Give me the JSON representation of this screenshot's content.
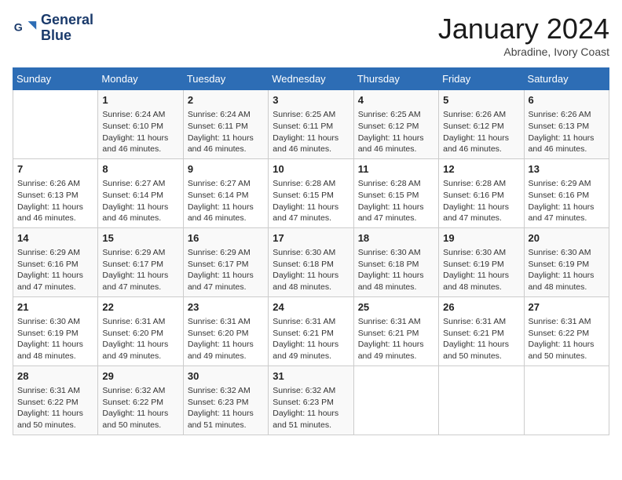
{
  "header": {
    "logo": {
      "line1": "General",
      "line2": "Blue"
    },
    "month": "January 2024",
    "location": "Abradine, Ivory Coast"
  },
  "weekdays": [
    "Sunday",
    "Monday",
    "Tuesday",
    "Wednesday",
    "Thursday",
    "Friday",
    "Saturday"
  ],
  "weeks": [
    [
      {
        "day": "",
        "info": ""
      },
      {
        "day": "1",
        "info": "Sunrise: 6:24 AM\nSunset: 6:10 PM\nDaylight: 11 hours\nand 46 minutes."
      },
      {
        "day": "2",
        "info": "Sunrise: 6:24 AM\nSunset: 6:11 PM\nDaylight: 11 hours\nand 46 minutes."
      },
      {
        "day": "3",
        "info": "Sunrise: 6:25 AM\nSunset: 6:11 PM\nDaylight: 11 hours\nand 46 minutes."
      },
      {
        "day": "4",
        "info": "Sunrise: 6:25 AM\nSunset: 6:12 PM\nDaylight: 11 hours\nand 46 minutes."
      },
      {
        "day": "5",
        "info": "Sunrise: 6:26 AM\nSunset: 6:12 PM\nDaylight: 11 hours\nand 46 minutes."
      },
      {
        "day": "6",
        "info": "Sunrise: 6:26 AM\nSunset: 6:13 PM\nDaylight: 11 hours\nand 46 minutes."
      }
    ],
    [
      {
        "day": "7",
        "info": "Sunrise: 6:26 AM\nSunset: 6:13 PM\nDaylight: 11 hours\nand 46 minutes."
      },
      {
        "day": "8",
        "info": "Sunrise: 6:27 AM\nSunset: 6:14 PM\nDaylight: 11 hours\nand 46 minutes."
      },
      {
        "day": "9",
        "info": "Sunrise: 6:27 AM\nSunset: 6:14 PM\nDaylight: 11 hours\nand 46 minutes."
      },
      {
        "day": "10",
        "info": "Sunrise: 6:28 AM\nSunset: 6:15 PM\nDaylight: 11 hours\nand 47 minutes."
      },
      {
        "day": "11",
        "info": "Sunrise: 6:28 AM\nSunset: 6:15 PM\nDaylight: 11 hours\nand 47 minutes."
      },
      {
        "day": "12",
        "info": "Sunrise: 6:28 AM\nSunset: 6:16 PM\nDaylight: 11 hours\nand 47 minutes."
      },
      {
        "day": "13",
        "info": "Sunrise: 6:29 AM\nSunset: 6:16 PM\nDaylight: 11 hours\nand 47 minutes."
      }
    ],
    [
      {
        "day": "14",
        "info": "Sunrise: 6:29 AM\nSunset: 6:16 PM\nDaylight: 11 hours\nand 47 minutes."
      },
      {
        "day": "15",
        "info": "Sunrise: 6:29 AM\nSunset: 6:17 PM\nDaylight: 11 hours\nand 47 minutes."
      },
      {
        "day": "16",
        "info": "Sunrise: 6:29 AM\nSunset: 6:17 PM\nDaylight: 11 hours\nand 47 minutes."
      },
      {
        "day": "17",
        "info": "Sunrise: 6:30 AM\nSunset: 6:18 PM\nDaylight: 11 hours\nand 48 minutes."
      },
      {
        "day": "18",
        "info": "Sunrise: 6:30 AM\nSunset: 6:18 PM\nDaylight: 11 hours\nand 48 minutes."
      },
      {
        "day": "19",
        "info": "Sunrise: 6:30 AM\nSunset: 6:19 PM\nDaylight: 11 hours\nand 48 minutes."
      },
      {
        "day": "20",
        "info": "Sunrise: 6:30 AM\nSunset: 6:19 PM\nDaylight: 11 hours\nand 48 minutes."
      }
    ],
    [
      {
        "day": "21",
        "info": "Sunrise: 6:30 AM\nSunset: 6:19 PM\nDaylight: 11 hours\nand 48 minutes."
      },
      {
        "day": "22",
        "info": "Sunrise: 6:31 AM\nSunset: 6:20 PM\nDaylight: 11 hours\nand 49 minutes."
      },
      {
        "day": "23",
        "info": "Sunrise: 6:31 AM\nSunset: 6:20 PM\nDaylight: 11 hours\nand 49 minutes."
      },
      {
        "day": "24",
        "info": "Sunrise: 6:31 AM\nSunset: 6:21 PM\nDaylight: 11 hours\nand 49 minutes."
      },
      {
        "day": "25",
        "info": "Sunrise: 6:31 AM\nSunset: 6:21 PM\nDaylight: 11 hours\nand 49 minutes."
      },
      {
        "day": "26",
        "info": "Sunrise: 6:31 AM\nSunset: 6:21 PM\nDaylight: 11 hours\nand 50 minutes."
      },
      {
        "day": "27",
        "info": "Sunrise: 6:31 AM\nSunset: 6:22 PM\nDaylight: 11 hours\nand 50 minutes."
      }
    ],
    [
      {
        "day": "28",
        "info": "Sunrise: 6:31 AM\nSunset: 6:22 PM\nDaylight: 11 hours\nand 50 minutes."
      },
      {
        "day": "29",
        "info": "Sunrise: 6:32 AM\nSunset: 6:22 PM\nDaylight: 11 hours\nand 50 minutes."
      },
      {
        "day": "30",
        "info": "Sunrise: 6:32 AM\nSunset: 6:23 PM\nDaylight: 11 hours\nand 51 minutes."
      },
      {
        "day": "31",
        "info": "Sunrise: 6:32 AM\nSunset: 6:23 PM\nDaylight: 11 hours\nand 51 minutes."
      },
      {
        "day": "",
        "info": ""
      },
      {
        "day": "",
        "info": ""
      },
      {
        "day": "",
        "info": ""
      }
    ]
  ]
}
